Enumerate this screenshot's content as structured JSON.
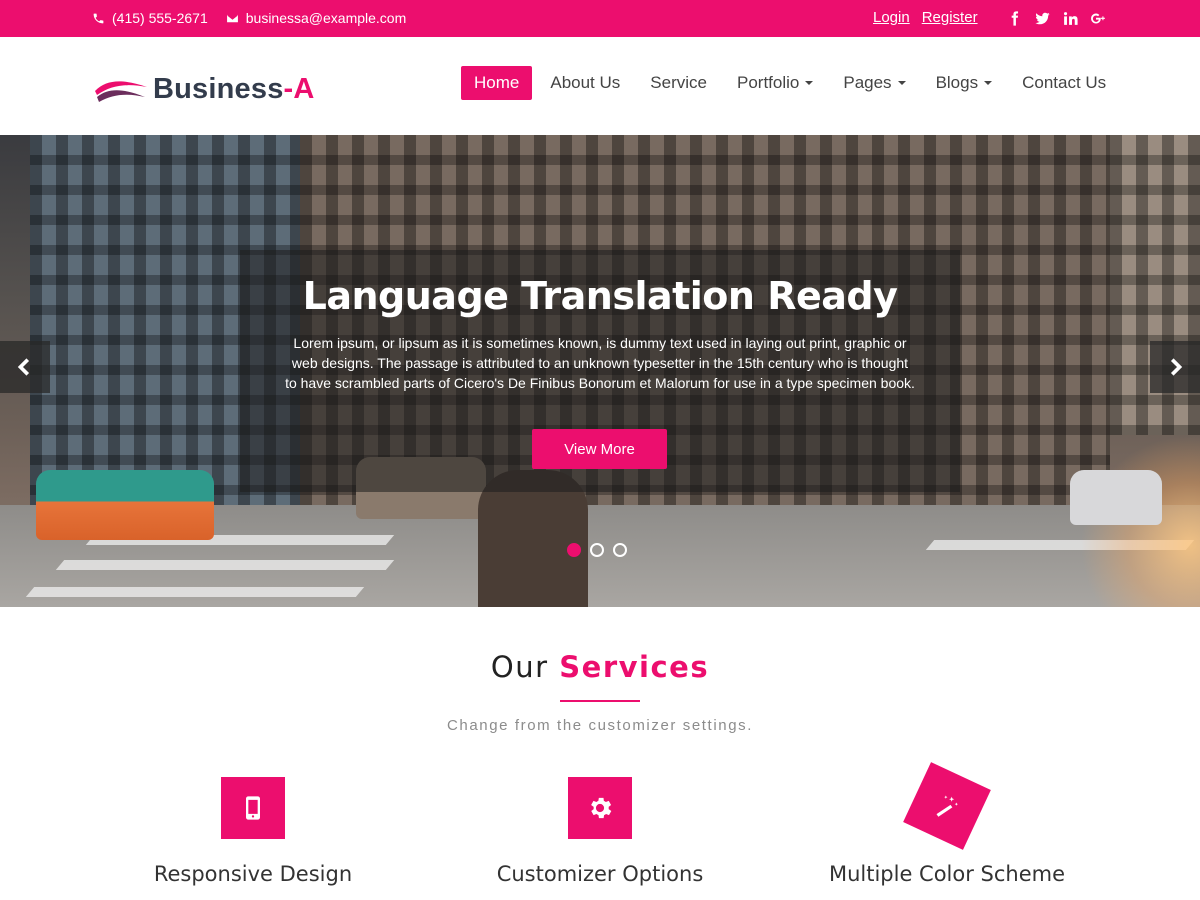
{
  "topbar": {
    "phone": "(415) 555-2671",
    "email": "businessa@example.com",
    "login": "Login",
    "register": "Register",
    "social": [
      "facebook-icon",
      "twitter-icon",
      "linkedin-icon",
      "google-plus-icon"
    ]
  },
  "brand": {
    "name_main": "Business",
    "name_dash": "-A",
    "accent_color": "#ec0e6e"
  },
  "nav": {
    "items": [
      {
        "label": "Home",
        "active": true
      },
      {
        "label": "About Us"
      },
      {
        "label": "Service"
      },
      {
        "label": "Portfolio",
        "dropdown": true
      },
      {
        "label": "Pages",
        "dropdown": true
      },
      {
        "label": "Blogs",
        "dropdown": true
      },
      {
        "label": "Contact Us"
      }
    ]
  },
  "hero": {
    "title": "Language Translation Ready",
    "text": "Lorem ipsum, or lipsum as it is sometimes known, is dummy text used in laying out print, graphic or web designs. The passage is attributed to an unknown typesetter in the 15th century who is thought to have scrambled parts of Cicero's De Finibus Bonorum et Malorum for use in a type specimen book.",
    "cta": "View More",
    "slides": 3,
    "active_slide": 1
  },
  "services": {
    "title_plain": "Our",
    "title_accent": "Services",
    "subtitle": "Change from the customizer settings.",
    "items": [
      {
        "icon": "mobile-icon",
        "label": "Responsive Design"
      },
      {
        "icon": "gear-icon",
        "label": "Customizer Options"
      },
      {
        "icon": "magic-wand-icon",
        "label": "Multiple Color Scheme"
      }
    ]
  }
}
